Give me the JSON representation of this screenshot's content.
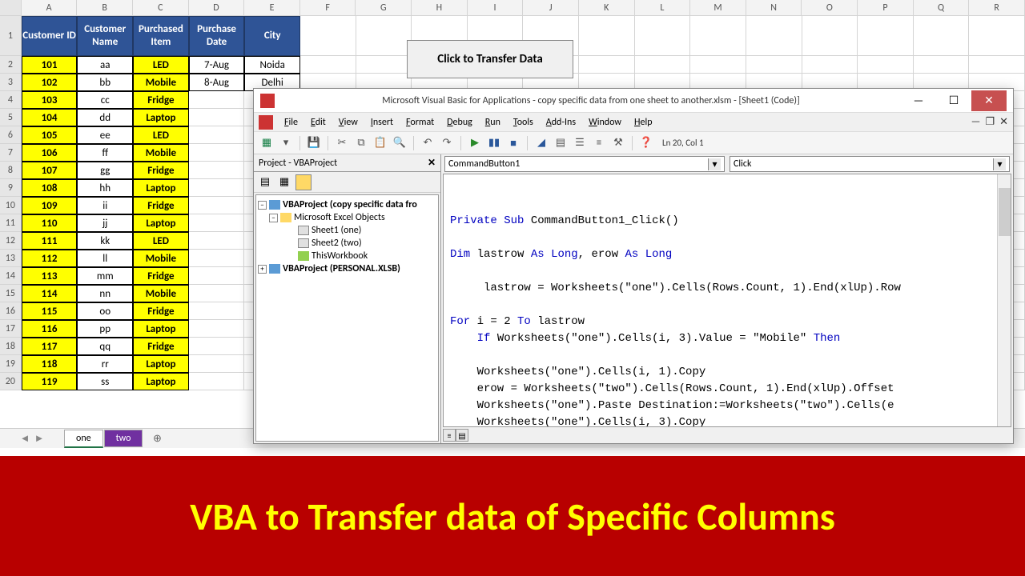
{
  "columns": [
    "A",
    "B",
    "C",
    "D",
    "E",
    "F",
    "G",
    "H",
    "I",
    "J",
    "K",
    "L",
    "M",
    "N",
    "O",
    "P",
    "Q",
    "R"
  ],
  "headers": [
    "Customer ID",
    "Customer Name",
    "Purchased Item",
    "Purchase Date",
    "City"
  ],
  "rows": [
    {
      "n": 1
    },
    {
      "n": 2,
      "id": "101",
      "name": "aa",
      "item": "LED",
      "date": "7-Aug",
      "city": "Noida"
    },
    {
      "n": 3,
      "id": "102",
      "name": "bb",
      "item": "Mobile",
      "date": "8-Aug",
      "city": "Delhi"
    },
    {
      "n": 4,
      "id": "103",
      "name": "cc",
      "item": "Fridge"
    },
    {
      "n": 5,
      "id": "104",
      "name": "dd",
      "item": "Laptop"
    },
    {
      "n": 6,
      "id": "105",
      "name": "ee",
      "item": "LED"
    },
    {
      "n": 7,
      "id": "106",
      "name": "ff",
      "item": "Mobile"
    },
    {
      "n": 8,
      "id": "107",
      "name": "gg",
      "item": "Fridge"
    },
    {
      "n": 9,
      "id": "108",
      "name": "hh",
      "item": "Laptop"
    },
    {
      "n": 10,
      "id": "109",
      "name": "ii",
      "item": "Fridge"
    },
    {
      "n": 11,
      "id": "110",
      "name": "jj",
      "item": "Laptop"
    },
    {
      "n": 12,
      "id": "111",
      "name": "kk",
      "item": "LED"
    },
    {
      "n": 13,
      "id": "112",
      "name": "ll",
      "item": "Mobile"
    },
    {
      "n": 14,
      "id": "113",
      "name": "mm",
      "item": "Fridge"
    },
    {
      "n": 15,
      "id": "114",
      "name": "nn",
      "item": "Mobile"
    },
    {
      "n": 16,
      "id": "115",
      "name": "oo",
      "item": "Fridge"
    },
    {
      "n": 17,
      "id": "116",
      "name": "pp",
      "item": "Laptop"
    },
    {
      "n": 18,
      "id": "117",
      "name": "qq",
      "item": "Fridge"
    },
    {
      "n": 19,
      "id": "118",
      "name": "rr",
      "item": "Laptop"
    },
    {
      "n": 20,
      "id": "119",
      "name": "ss",
      "item": "Laptop"
    }
  ],
  "transfer_button": "Click to Transfer Data",
  "tabs": {
    "one": "one",
    "two": "two"
  },
  "vba": {
    "title": "Microsoft Visual Basic for Applications - copy specific data from one sheet to another.xlsm - [Sheet1 (Code)]",
    "menus": [
      "File",
      "Edit",
      "View",
      "Insert",
      "Format",
      "Debug",
      "Run",
      "Tools",
      "Add-Ins",
      "Window",
      "Help"
    ],
    "status": "Ln 20, Col 1",
    "project_title": "Project - VBAProject",
    "tree": {
      "root1": "VBAProject (copy specific data fro",
      "folder": "Microsoft Excel Objects",
      "sheet1": "Sheet1 (one)",
      "sheet2": "Sheet2 (two)",
      "workbook": "ThisWorkbook",
      "root2": "VBAProject (PERSONAL.XLSB)"
    },
    "selector_left": "CommandButton1",
    "selector_right": "Click",
    "code_lines": [
      {
        "t": "Private Sub CommandButton1_Click()",
        "kw": [
          "Private",
          "Sub"
        ]
      },
      {
        "t": ""
      },
      {
        "t": "Dim lastrow As Long, erow As Long",
        "kw": [
          "Dim",
          "As",
          "Long"
        ]
      },
      {
        "t": ""
      },
      {
        "t": "     lastrow = Worksheets(\"one\").Cells(Rows.Count, 1).End(xlUp).Row"
      },
      {
        "t": ""
      },
      {
        "t": "For i = 2 To lastrow",
        "kw": [
          "For",
          "To"
        ]
      },
      {
        "t": "    If Worksheets(\"one\").Cells(i, 3).Value = \"Mobile\" Then",
        "kw": [
          "If",
          "Then"
        ]
      },
      {
        "t": ""
      },
      {
        "t": "    Worksheets(\"one\").Cells(i, 1).Copy"
      },
      {
        "t": "    erow = Worksheets(\"two\").Cells(Rows.Count, 1).End(xlUp).Offset"
      },
      {
        "t": "    Worksheets(\"one\").Paste Destination:=Worksheets(\"two\").Cells(e"
      },
      {
        "t": "    Worksheets(\"one\").Cells(i, 3).Copy"
      }
    ]
  },
  "banner": "VBA to Transfer data of Specific Columns"
}
